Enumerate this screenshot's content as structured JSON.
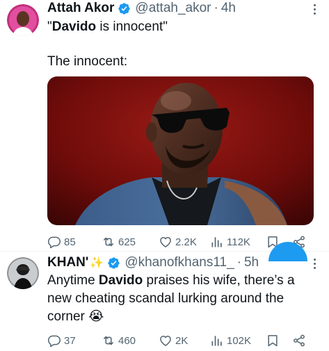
{
  "tweets": [
    {
      "author_name": "Attah Akor",
      "handle": "@attah_akor",
      "separator": "·",
      "time": "4h",
      "text_line1": "\"",
      "text_line1_bold": "Davido",
      "text_line1_rest": " is innocent\"",
      "text_line2": "The innocent:",
      "replies": "85",
      "retweets": "625",
      "likes": "2.2K",
      "views": "112K"
    },
    {
      "author_name": "KHAN'",
      "sparkle": "✨",
      "handle": "@khanofkhans11_",
      "separator": "·",
      "time": "5h",
      "text_a": "Anytime ",
      "text_bold": "Davido",
      "text_b": " praises his wife, there’s a",
      "text_line2": "new cheating scandal lurking around the",
      "text_line3": "corner",
      "emoji": "😭",
      "replies": "37",
      "retweets": "460",
      "likes": "2K",
      "views": "102K"
    }
  ],
  "icons": {
    "verified": "verified-badge-icon",
    "more": "more-icon",
    "reply": "reply-icon",
    "retweet": "retweet-icon",
    "like": "heart-icon",
    "views": "views-icon",
    "bookmark": "bookmark-icon",
    "share": "share-icon"
  },
  "colors": {
    "text": "#0f1419",
    "muted": "#536471",
    "verified": "#1d9bf0",
    "media_bg": "#7a1010"
  }
}
